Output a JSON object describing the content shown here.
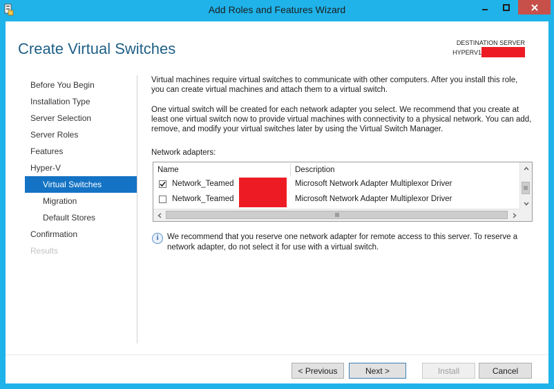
{
  "window": {
    "title": "Add Roles and Features Wizard",
    "accent_color": "#1fb3ea",
    "close_color": "#c7504b"
  },
  "header": {
    "page_title": "Create Virtual Switches",
    "destination_label": "DESTINATION SERVER",
    "server_name_prefix": "HYPERV1"
  },
  "nav": {
    "items": [
      {
        "label": "Before You Begin",
        "state": "normal",
        "level": 0
      },
      {
        "label": "Installation Type",
        "state": "normal",
        "level": 0
      },
      {
        "label": "Server Selection",
        "state": "normal",
        "level": 0
      },
      {
        "label": "Server Roles",
        "state": "normal",
        "level": 0
      },
      {
        "label": "Features",
        "state": "normal",
        "level": 0
      },
      {
        "label": "Hyper-V",
        "state": "normal",
        "level": 0
      },
      {
        "label": "Virtual Switches",
        "state": "active",
        "level": 1
      },
      {
        "label": "Migration",
        "state": "normal",
        "level": 1
      },
      {
        "label": "Default Stores",
        "state": "normal",
        "level": 1
      },
      {
        "label": "Confirmation",
        "state": "normal",
        "level": 0
      },
      {
        "label": "Results",
        "state": "disabled",
        "level": 0
      }
    ]
  },
  "content": {
    "paragraph1": "Virtual machines require virtual switches to communicate with other computers. After you install this role, you can create virtual machines and attach them to a virtual switch.",
    "paragraph2": "One virtual switch will be created for each network adapter you select. We recommend that you create at least one virtual switch now to provide virtual machines with connectivity to a physical network. You can add, remove, and modify your virtual switches later by using the Virtual Switch Manager.",
    "adapters_label": "Network adapters:",
    "table": {
      "columns": [
        "Name",
        "Description"
      ],
      "rows": [
        {
          "checked": true,
          "name": "Network_Teamed",
          "description": "Microsoft Network Adapter Multiplexor Driver"
        },
        {
          "checked": false,
          "name": "Network_Teamed",
          "description": "Microsoft Network Adapter Multiplexor Driver"
        }
      ]
    },
    "info_text": "We recommend that you reserve one network adapter for remote access to this server. To reserve a network adapter, do not select it for use with a virtual switch."
  },
  "buttons": {
    "previous": "< Previous",
    "next": "Next >",
    "install": "Install",
    "cancel": "Cancel"
  },
  "redaction_color": "#ed1c24"
}
